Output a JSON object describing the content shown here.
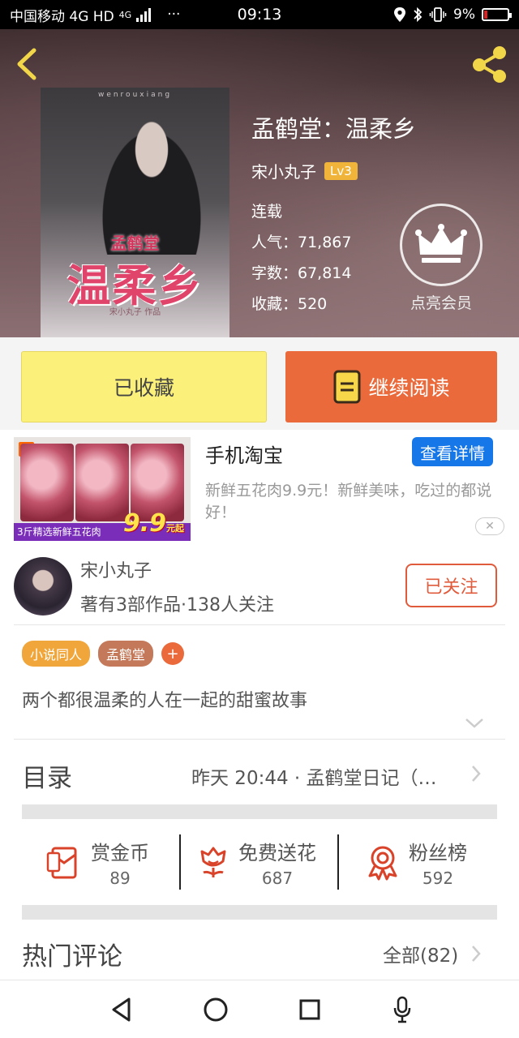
{
  "status_bar": {
    "carrier": "中国移动 4G HD",
    "network": "4G",
    "more": "···",
    "time": "09:13",
    "battery": "9%",
    "battery_color": "#e02020"
  },
  "book": {
    "cover_pinyin": "wenrouxiang",
    "cover_small": "孟鹤堂",
    "cover_big": "温柔乡",
    "cover_author": "宋小丸子 作品",
    "title": "孟鹤堂：温柔乡",
    "author": "宋小丸子",
    "level": "Lv3",
    "status": "连载",
    "popularity": "人气：71,867",
    "word_count": "字数：67,814",
    "favorites": "收藏：520",
    "vip_label": "点亮会员"
  },
  "actions": {
    "collect_label": "已收藏",
    "read_label": "继续阅读"
  },
  "ad": {
    "badge": "淘",
    "strip_text": "3斤精选新鲜五花肉",
    "price": "9.9",
    "price_unit": "元起",
    "title": "手机淘宝",
    "button": "查看详情",
    "description": "新鲜五花肉9.9元！新鲜美味，吃过的都说好！",
    "close": "✕"
  },
  "author_card": {
    "name": "宋小丸子",
    "stats": "著有3部作品·138人关注",
    "follow_label": "已关注"
  },
  "tags": [
    {
      "label": "小说同人",
      "color": "#f0a63a"
    },
    {
      "label": "孟鹤堂",
      "color": "#c47a5a"
    }
  ],
  "tag_add": "+",
  "synopsis": "两个都很温柔的人在一起的甜蜜故事",
  "toc": {
    "label": "目录",
    "latest": "昨天 20:44 · 孟鹤堂日记（…"
  },
  "stats": [
    {
      "label": "赏金币",
      "value": "89",
      "icon": "red-envelope-icon"
    },
    {
      "label": "免费送花",
      "value": "687",
      "icon": "flower-icon"
    },
    {
      "label": "粉丝榜",
      "value": "592",
      "icon": "medal-icon"
    }
  ],
  "comments": {
    "label": "热门评论",
    "all_label": "全部(82)"
  },
  "colors": {
    "accent_orange": "#ea6a3b",
    "collect_yellow": "#fbf17a",
    "icon_red": "#d9432a",
    "link_blue": "#1677e8"
  }
}
